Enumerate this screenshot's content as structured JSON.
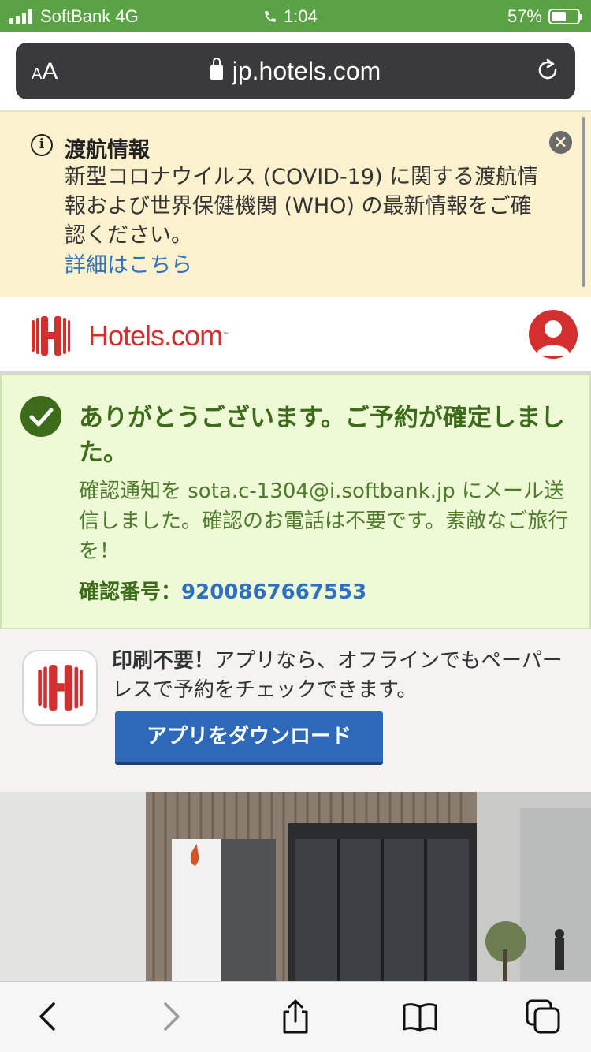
{
  "status_bar": {
    "carrier": "SoftBank 4G",
    "time": "1:04",
    "battery": "57%",
    "battery_level": 0.57
  },
  "browser": {
    "text_size_small": "A",
    "text_size_large": "A",
    "url": "jp.hotels.com"
  },
  "notice": {
    "title": "渡航情報",
    "body": "新型コロナウイルス (COVID-19) に関する渡航情報および世界保健機関 (WHO) の最新情報をご確認ください。",
    "link": "詳細はこちら",
    "close_symbol": "×"
  },
  "header": {
    "logo_text": "Hotels.com",
    "logo_tm": "™"
  },
  "confirmation": {
    "title": "ありがとうございます。ご予約が確定しました。",
    "body": "確認通知を sota.c-1304@i.softbank.jp にメール送信しました。確認のお電話は不要です。素敵なご旅行を！",
    "number_label": "確認番号：",
    "number_value": "9200867667553"
  },
  "promo": {
    "bold_text": "印刷不要！",
    "text": "アプリなら、オフラインでもペーパーレスで予約をチェックできます。",
    "button_label": "アプリをダウンロード"
  },
  "colors": {
    "brand": "#d32f2f",
    "status_green": "#5aa345",
    "success_text": "#3c6b1a",
    "button_blue": "#2e68b8"
  },
  "icons": [
    "signal-icon",
    "phone-icon",
    "battery-icon",
    "lock-icon",
    "reload-icon",
    "info-icon",
    "close-icon",
    "hotels-logo-icon",
    "avatar-icon",
    "check-icon",
    "app-icon",
    "back-icon",
    "forward-icon",
    "share-icon",
    "bookmarks-icon",
    "tabs-icon"
  ]
}
